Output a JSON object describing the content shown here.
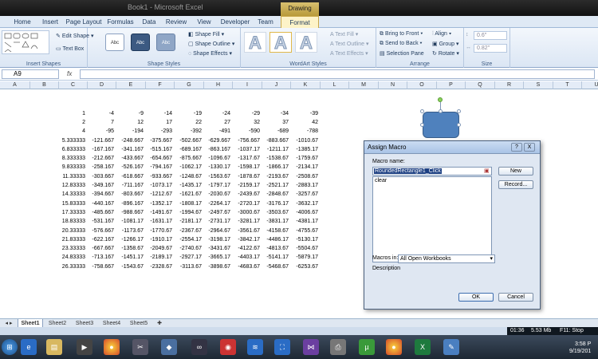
{
  "window": {
    "title": "Book1 - Microsoft Excel",
    "context_tab_group": "Drawing Tools"
  },
  "tabs": [
    "Home",
    "Insert",
    "Page Layout",
    "Formulas",
    "Data",
    "Review",
    "View",
    "Developer",
    "Team",
    "Format"
  ],
  "active_tab": "Format",
  "ribbon": {
    "insert_shapes": {
      "label": "Insert Shapes",
      "edit_shape": "Edit Shape",
      "text_box": "Text Box"
    },
    "shape_styles": {
      "label": "Shape Styles",
      "styles": [
        "Abc",
        "Abc",
        "Abc"
      ],
      "shape_fill": "Shape Fill",
      "shape_outline": "Shape Outline",
      "shape_effects": "Shape Effects"
    },
    "wordart": {
      "label": "WordArt Styles",
      "text_fill": "Text Fill",
      "text_outline": "Text Outline",
      "text_effects": "Text Effects",
      "glyph": "A"
    },
    "arrange": {
      "label": "Arrange",
      "bring_to_front": "Bring to Front",
      "send_to_back": "Send to Back",
      "selection_pane": "Selection Pane",
      "align": "Align",
      "group": "Group",
      "rotate": "Rotate"
    },
    "size": {
      "label": "Size",
      "height": "0.6\"",
      "width": "0.82\""
    }
  },
  "formula_bar": {
    "name_box": "A9",
    "fx": "fx",
    "content": ""
  },
  "columns": [
    "A",
    "B",
    "C",
    "D",
    "E",
    "F",
    "G",
    "H",
    "I",
    "J",
    "K",
    "L",
    "M",
    "N",
    "O",
    "P",
    "Q",
    "R",
    "S",
    "T",
    "U"
  ],
  "rows": [
    [
      "",
      "",
      "",
      "",
      "",
      "",
      "",
      ""
    ],
    [
      "",
      "",
      "",
      "",
      "",
      "",
      "",
      ""
    ],
    [
      "1",
      "-4",
      "-9",
      "-14",
      "-19",
      "-24",
      "-29",
      "-34",
      "-39"
    ],
    [
      "2",
      "7",
      "12",
      "17",
      "22",
      "27",
      "32",
      "37",
      "42"
    ],
    [
      "4",
      "-95",
      "-194",
      "-293",
      "-392",
      "-491",
      "-590",
      "-689",
      "-788"
    ],
    [
      "5.333333",
      "-121.667",
      "-248.667",
      "-375.667",
      "-502.667",
      "-629.667",
      "-756.667",
      "-883.667",
      "-1010.67"
    ],
    [
      "6.833333",
      "-167.167",
      "-341.167",
      "-515.167",
      "-689.167",
      "-863.167",
      "-1037.17",
      "-1211.17",
      "-1385.17"
    ],
    [
      "8.333333",
      "-212.667",
      "-433.667",
      "-654.667",
      "-875.667",
      "-1096.67",
      "-1317.67",
      "-1538.67",
      "-1759.67"
    ],
    [
      "9.833333",
      "-258.167",
      "-526.167",
      "-794.167",
      "-1062.17",
      "-1330.17",
      "-1598.17",
      "-1866.17",
      "-2134.17"
    ],
    [
      "11.33333",
      "-303.667",
      "-618.667",
      "-933.667",
      "-1248.67",
      "-1563.67",
      "-1878.67",
      "-2193.67",
      "-2508.67"
    ],
    [
      "12.83333",
      "-349.167",
      "-711.167",
      "-1073.17",
      "-1435.17",
      "-1797.17",
      "-2159.17",
      "-2521.17",
      "-2883.17"
    ],
    [
      "14.33333",
      "-394.667",
      "-803.667",
      "-1212.67",
      "-1621.67",
      "-2030.67",
      "-2439.67",
      "-2848.67",
      "-3257.67"
    ],
    [
      "15.83333",
      "-440.167",
      "-896.167",
      "-1352.17",
      "-1808.17",
      "-2264.17",
      "-2720.17",
      "-3176.17",
      "-3632.17"
    ],
    [
      "17.33333",
      "-485.667",
      "-988.667",
      "-1491.67",
      "-1994.67",
      "-2497.67",
      "-3000.67",
      "-3503.67",
      "-4006.67"
    ],
    [
      "18.83333",
      "-531.167",
      "-1081.17",
      "-1631.17",
      "-2181.17",
      "-2731.17",
      "-3281.17",
      "-3831.17",
      "-4381.17"
    ],
    [
      "20.33333",
      "-576.667",
      "-1173.67",
      "-1770.67",
      "-2367.67",
      "-2964.67",
      "-3561.67",
      "-4158.67",
      "-4755.67"
    ],
    [
      "21.83333",
      "-622.167",
      "-1266.17",
      "-1910.17",
      "-2554.17",
      "-3198.17",
      "-3842.17",
      "-4486.17",
      "-5130.17"
    ],
    [
      "23.33333",
      "-667.667",
      "-1358.67",
      "-2049.67",
      "-2740.67",
      "-3431.67",
      "-4122.67",
      "-4813.67",
      "-5504.67"
    ],
    [
      "24.83333",
      "-713.167",
      "-1451.17",
      "-2189.17",
      "-2927.17",
      "-3665.17",
      "-4403.17",
      "-5141.17",
      "-5879.17"
    ],
    [
      "26.33333",
      "-758.667",
      "-1543.67",
      "-2328.67",
      "-3113.67",
      "-3898.67",
      "-4683.67",
      "-5468.67",
      "-6253.67"
    ]
  ],
  "dialog": {
    "title": "Assign Macro",
    "help": "?",
    "close": "X",
    "macro_name_label": "Macro name:",
    "macro_name_value": "RoundedRectangle1_Click",
    "macro_list": [
      "clear"
    ],
    "new_button": "New",
    "record_button": "Record...",
    "macros_in_label": "Macros in:",
    "macros_in_value": "All Open Workbooks",
    "description_label": "Description",
    "ok_button": "OK",
    "cancel_button": "Cancel"
  },
  "sheets": [
    "Sheet1",
    "Sheet2",
    "Sheet3",
    "Sheet4",
    "Sheet5"
  ],
  "active_sheet": "Sheet1",
  "tray": {
    "time_elapsed": "01:36",
    "memory": "5.53 Mb",
    "stop": "F11: Stop"
  },
  "clock": {
    "time": "3:58 P",
    "date": "9/19/201"
  }
}
